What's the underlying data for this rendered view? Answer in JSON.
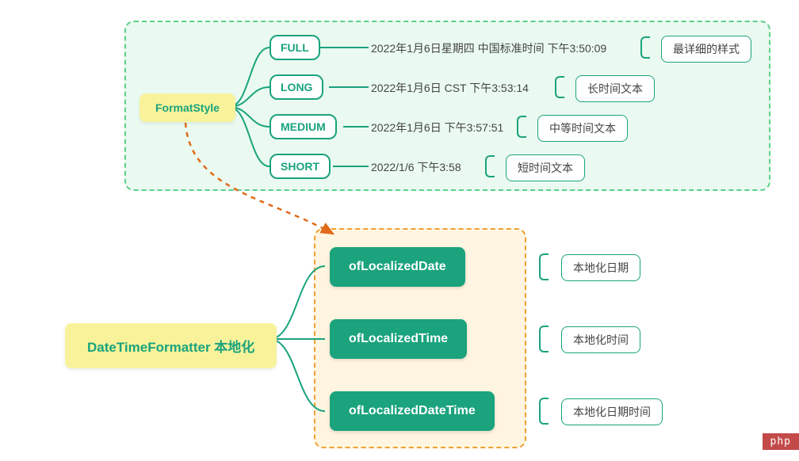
{
  "top": {
    "root": "FormatStyle",
    "children": [
      {
        "name": "FULL",
        "example": "2022年1月6日星期四 中国标准时间 下午3:50:09",
        "note": "最详细的样式"
      },
      {
        "name": "LONG",
        "example": "2022年1月6日 CST 下午3:53:14",
        "note": "长时间文本"
      },
      {
        "name": "MEDIUM",
        "example": "2022年1月6日 下午3:57:51",
        "note": "中等时间文本"
      },
      {
        "name": "SHORT",
        "example": "2022/1/6 下午3:58",
        "note": "短时间文本"
      }
    ]
  },
  "bottom": {
    "root": "DateTimeFormatter 本地化",
    "children": [
      {
        "name": "ofLocalizedDate",
        "note": "本地化日期"
      },
      {
        "name": "ofLocalizedTime",
        "note": "本地化时间"
      },
      {
        "name": "ofLocalizedDateTime",
        "note": "本地化日期时间"
      }
    ]
  },
  "watermark": "php"
}
